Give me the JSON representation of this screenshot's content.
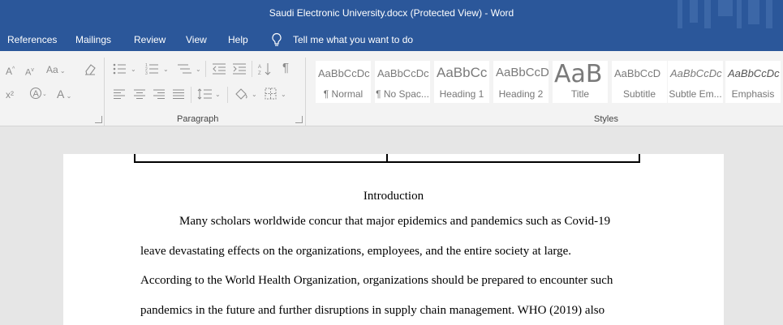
{
  "window": {
    "title": "Saudi Electronic University.docx (Protected View)  -  Word"
  },
  "menu": {
    "tabs": [
      "References",
      "Mailings",
      "Review",
      "View",
      "Help"
    ],
    "tell_me": "Tell me what you want to do"
  },
  "ribbon": {
    "font_tools": {
      "aa": "Aa",
      "a": "A",
      "superscript": "x²"
    },
    "paragraph_label": "Paragraph",
    "styles_label": "Styles",
    "styles": [
      {
        "sample": "AaBbCcDc",
        "name": "¶ Normal"
      },
      {
        "sample": "AaBbCcDc",
        "name": "¶ No Spac..."
      },
      {
        "sample": "AaBbCc",
        "name": "Heading 1"
      },
      {
        "sample": "AaBbCcD",
        "name": "Heading 2"
      },
      {
        "sample": "AaB",
        "name": "Title"
      },
      {
        "sample": "AaBbCcD",
        "name": "Subtitle"
      },
      {
        "sample": "AaBbCcDc",
        "name": "Subtle Em..."
      },
      {
        "sample": "AaBbCcDc",
        "name": "Emphasis"
      }
    ]
  },
  "document": {
    "heading": "Introduction",
    "lines": [
      "Many scholars worldwide concur that major epidemics and pandemics such as Covid-19",
      "leave devastating effects on the organizations, employees, and the entire society at large.",
      "According to the World Health Organization, organizations should be prepared to encounter such",
      "pandemics in the future and further disruptions in supply chain management. WHO (2019) also"
    ]
  },
  "colors": {
    "accent": "#2b579a",
    "ribbon": "#f3f3f3",
    "canvas": "#e6e6e6"
  }
}
